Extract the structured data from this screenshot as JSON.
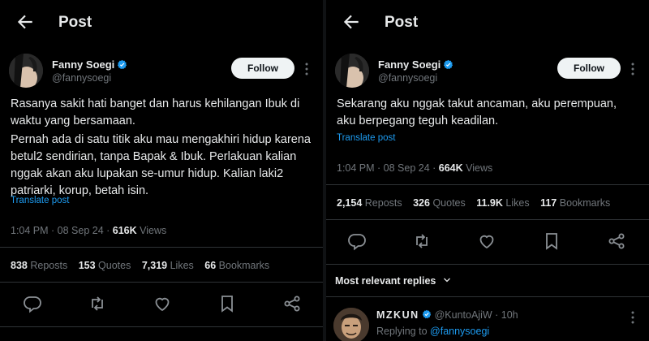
{
  "left": {
    "header": {
      "title": "Post"
    },
    "author": {
      "name": "Fanny Soegi",
      "handle": "@fannysoegi",
      "follow_label": "Follow"
    },
    "body": [
      "Rasanya sakit hati banget dan harus kehilangan Ibuk di waktu yang bersamaan.",
      "Pernah ada di satu titik aku mau mengakhiri hidup karena betul2 sendirian, tanpa Bapak & Ibuk. Perlakuan kalian nggak akan aku lupakan se-umur hidup. Kalian laki2 patriarki, korup, betah isin."
    ],
    "translate_label": "Translate post",
    "time": "1:04 PM",
    "date": "08 Sep 24",
    "views": "616K",
    "views_label": "Views",
    "stats": {
      "reposts": "838",
      "reposts_label": "Reposts",
      "quotes": "153",
      "quotes_label": "Quotes",
      "likes": "7,319",
      "likes_label": "Likes",
      "bookmarks": "66",
      "bookmarks_label": "Bookmarks"
    }
  },
  "right": {
    "header": {
      "title": "Post"
    },
    "author": {
      "name": "Fanny Soegi",
      "handle": "@fannysoegi",
      "follow_label": "Follow"
    },
    "body": [
      "Sekarang aku nggak takut ancaman, aku perempuan, aku berpegang teguh keadilan."
    ],
    "translate_label": "Translate post",
    "time": "1:04 PM",
    "date": "08 Sep 24",
    "views": "664K",
    "views_label": "Views",
    "stats": {
      "reposts": "2,154",
      "reposts_label": "Reposts",
      "quotes": "326",
      "quotes_label": "Quotes",
      "likes": "11.9K",
      "likes_label": "Likes",
      "bookmarks": "117",
      "bookmarks_label": "Bookmarks"
    },
    "replies_filter": "Most relevant replies",
    "reply": {
      "name": "MZKUN",
      "handle": "@KuntoAjiW",
      "age": "10h",
      "replying_prefix": "Replying to",
      "replying_to": "@fannysoegi"
    }
  },
  "icons": [
    "back-arrow-icon",
    "verified-icon",
    "more-icon",
    "reply-icon",
    "repost-icon",
    "like-icon",
    "bookmark-icon",
    "share-icon",
    "chevron-down-icon"
  ],
  "colors": {
    "background": "#000000",
    "accent": "#1d9bf0",
    "muted": "#71767b",
    "text": "#e7e9ea"
  }
}
